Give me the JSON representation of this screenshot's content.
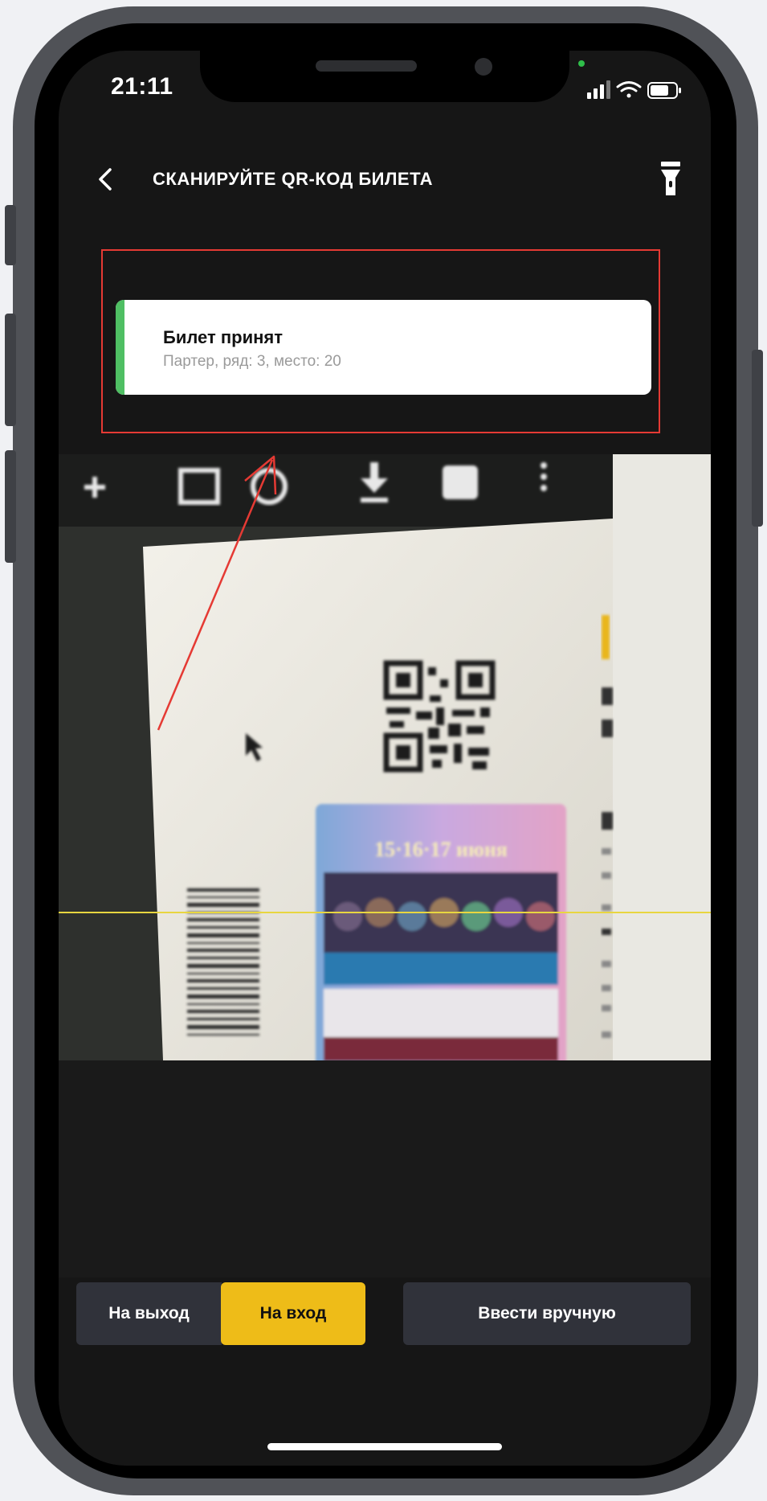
{
  "status_bar": {
    "time": "21:11"
  },
  "header": {
    "title": "СКАНИРУЙТЕ QR-КОД БИЛЕТА",
    "back_icon": "chevron-left-icon",
    "flash_icon": "flashlight-icon"
  },
  "toast": {
    "title": "Билет принят",
    "subtitle": "Партер, ряд: 3, место: 20",
    "accent_color": "#4fbf63"
  },
  "camera": {
    "ticket_image_text": "15·16·17 июня"
  },
  "mode_toggle": {
    "exit_label": "На выход",
    "enter_label": "На вход",
    "selected": "На вход",
    "accent_color": "#eebc18"
  },
  "manual_entry": {
    "label": "Ввести вручную"
  },
  "annotation": {
    "highlight_color": "#e53a34"
  }
}
